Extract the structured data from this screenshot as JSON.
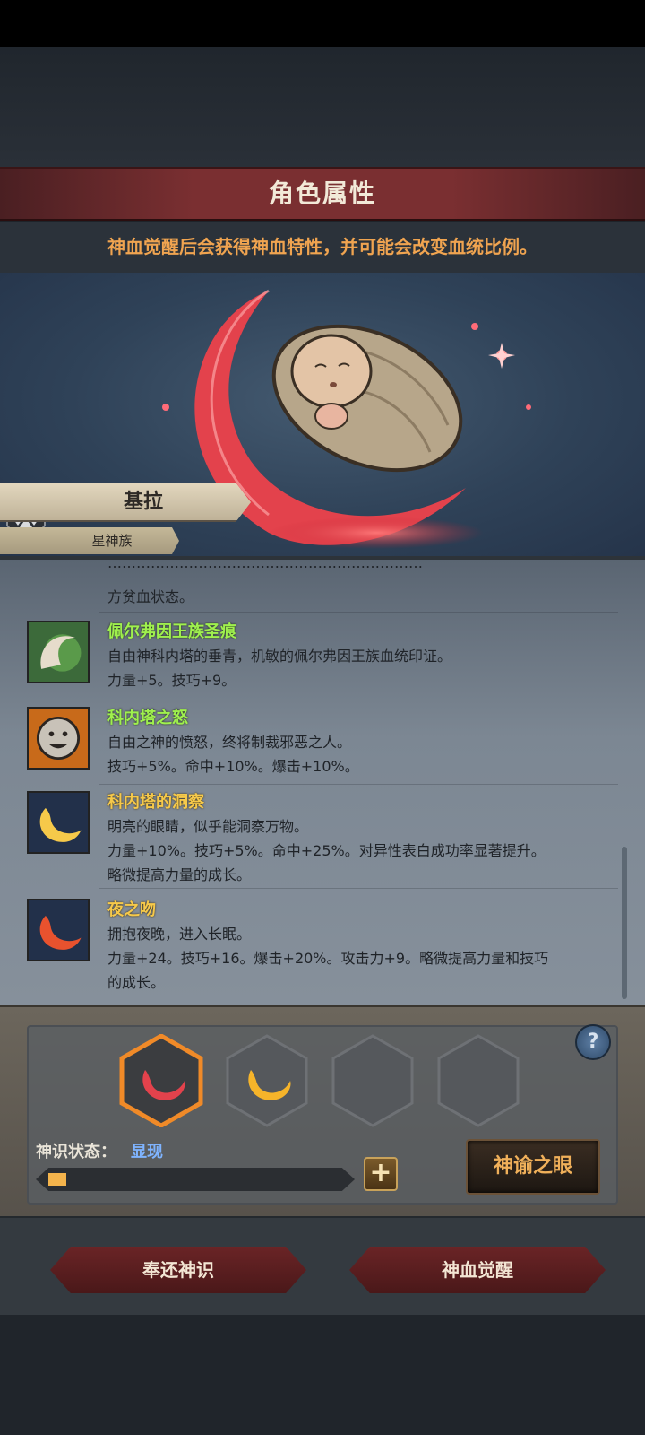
{
  "header": {
    "title": "角色属性",
    "hint": "神血觉醒后会获得神血特性，并可能会改变血统比例。"
  },
  "character": {
    "name": "基拉",
    "race": "星神族"
  },
  "traits_partial": {
    "line1": "…………………………………………………………",
    "line2": "方贫血状态。"
  },
  "traits": [
    {
      "name": "佩尔弗因王族圣痕",
      "desc1": "自由神科内塔的垂青，机敏的佩尔弗因王族血统印证。",
      "desc2": "力量+5。技巧+9。",
      "desc3": ""
    },
    {
      "name": "科内塔之怒",
      "desc1": "自由之神的愤怒，终将制裁邪恶之人。",
      "desc2": "技巧+5%。命中+10%。爆击+10%。",
      "desc3": ""
    },
    {
      "name": "科内塔的洞察",
      "desc1": "明亮的眼睛，似乎能洞察万物。",
      "desc2": "力量+10%。技巧+5%。命中+25%。对异性表白成功率显著提升。",
      "desc3": "略微提高力量的成长。"
    },
    {
      "name": "夜之吻",
      "desc1": "拥抱夜晚，进入长眠。",
      "desc2": "力量+24。技巧+16。爆击+20%。攻击力+9。略微提高力量和技巧",
      "desc3": "的成长。"
    }
  ],
  "awakening": {
    "status_label": "神识状态：",
    "status_value": "显现",
    "progress": 0.06,
    "help_label": "?",
    "plus_label": "+",
    "oracle_button": "神谕之眼"
  },
  "footer": {
    "return_button": "奉还神识",
    "awaken_button": "神血觉醒"
  },
  "colors": {
    "trait_green": "#9ff04e",
    "trait_gold": "#f6c94a",
    "accent_orange": "#f0a450",
    "crimson": "#e3424c"
  }
}
